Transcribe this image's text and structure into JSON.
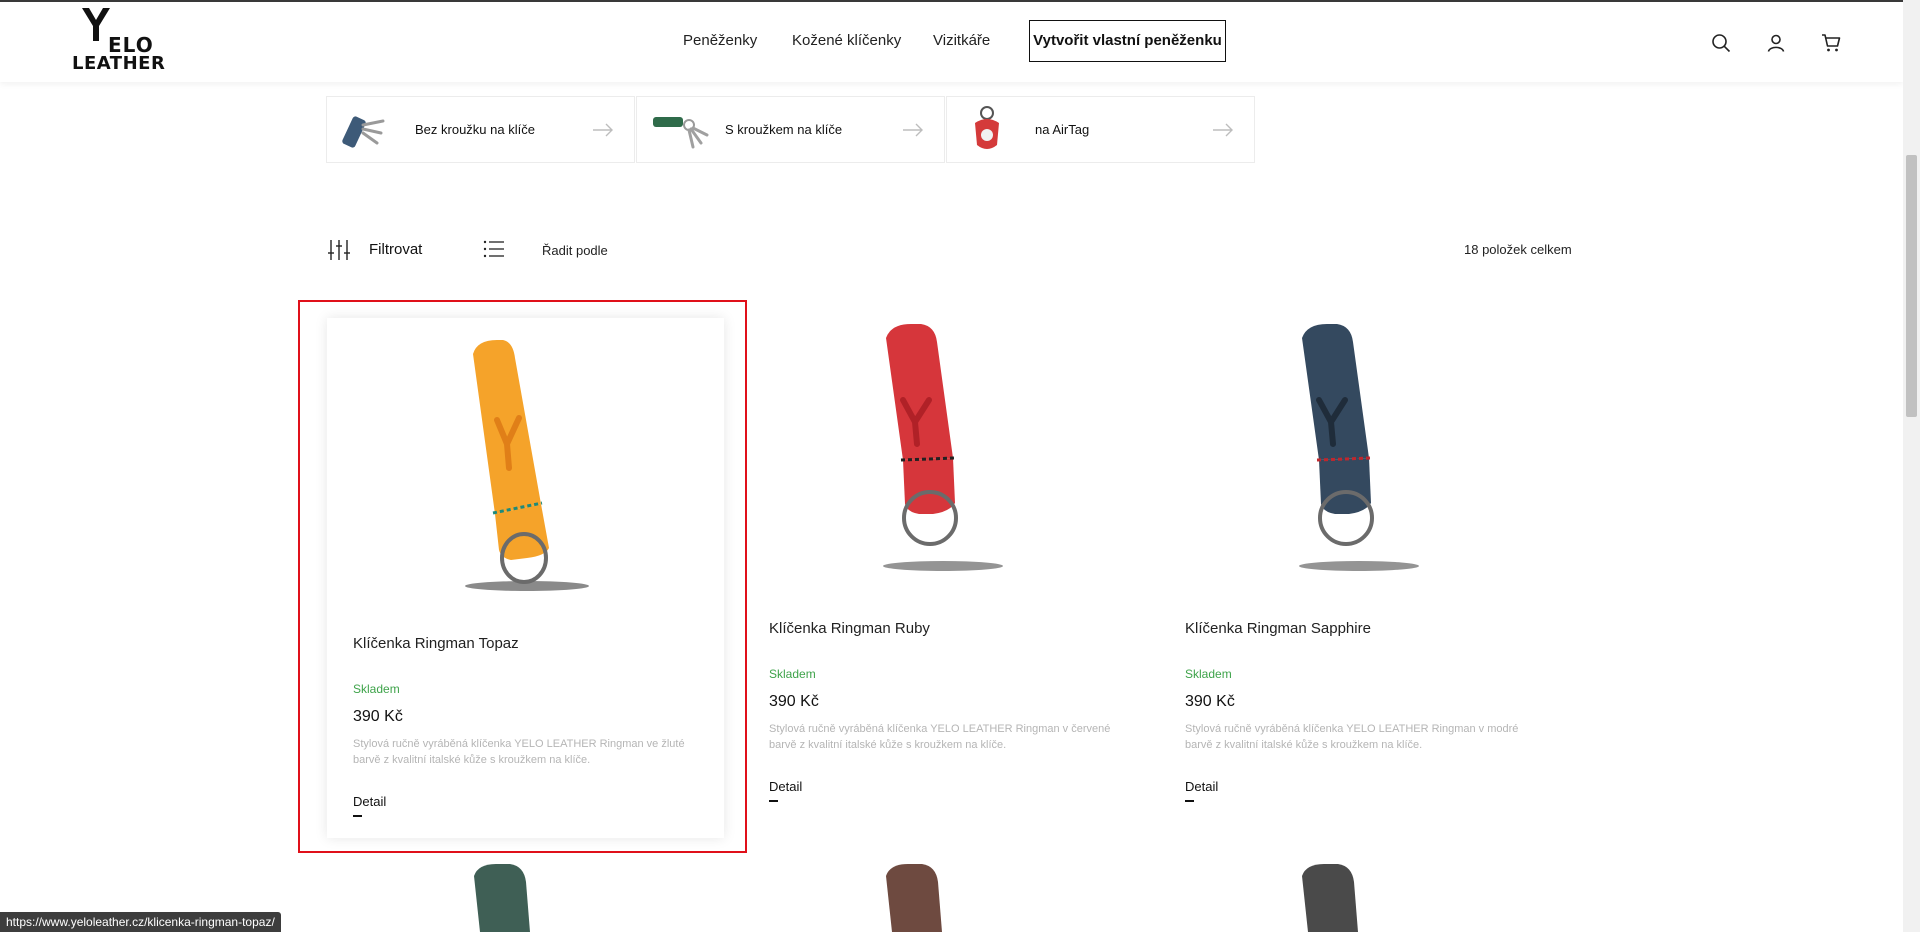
{
  "brand": {
    "line1": "ELO",
    "line2": "LEATHER"
  },
  "nav": {
    "items": [
      "Peněženky",
      "Kožené klíčenky",
      "Vizitkáře"
    ],
    "cta": "Vytvořit vlastní peněženku"
  },
  "header_icons": [
    "search-icon",
    "user-icon",
    "cart-icon"
  ],
  "categories": [
    {
      "label": "Bez kroužku na klíče",
      "color": "#3d5a78"
    },
    {
      "label": "S kroužkem na klíče",
      "color": "#2f6b4a"
    },
    {
      "label": "na AirTag",
      "color": "#d43a3a"
    }
  ],
  "toolbar": {
    "filter_label": "Filtrovat",
    "sort_label": "Řadit podle",
    "count_label": "18 položek celkem"
  },
  "products": [
    {
      "name": "Klíčenka Ringman Topaz",
      "stock": "Skladem",
      "price": "390 Kč",
      "description": "Stylová ručně vyráběná klíčenka YELO LEATHER Ringman ve žluté barvě z kvalitní italské kůže s kroužkem na klíče.",
      "detail": "Detail",
      "color": "#f5a32a"
    },
    {
      "name": "Klíčenka Ringman Ruby",
      "stock": "Skladem",
      "price": "390 Kč",
      "description": "Stylová ručně vyráběná klíčenka YELO LEATHER Ringman v červené barvě z kvalitní italské kůže s kroužkem na klíče.",
      "detail": "Detail",
      "color": "#d6363b"
    },
    {
      "name": "Klíčenka Ringman Sapphire",
      "stock": "Skladem",
      "price": "390 Kč",
      "description": "Stylová ručně vyráběná klíčenka YELO LEATHER Ringman v modré barvě z kvalitní italské kůže s kroužkem na klíče.",
      "detail": "Detail",
      "color": "#34495f"
    }
  ],
  "more_products_colors": [
    "#3f5f55",
    "#6e4a40",
    "#4a4a4a"
  ],
  "status_url": "https://www.yeloleather.cz/klicenka-ringman-topaz/",
  "colors": {
    "stock_green": "#3ea34a",
    "highlight_red": "#e0101a"
  }
}
